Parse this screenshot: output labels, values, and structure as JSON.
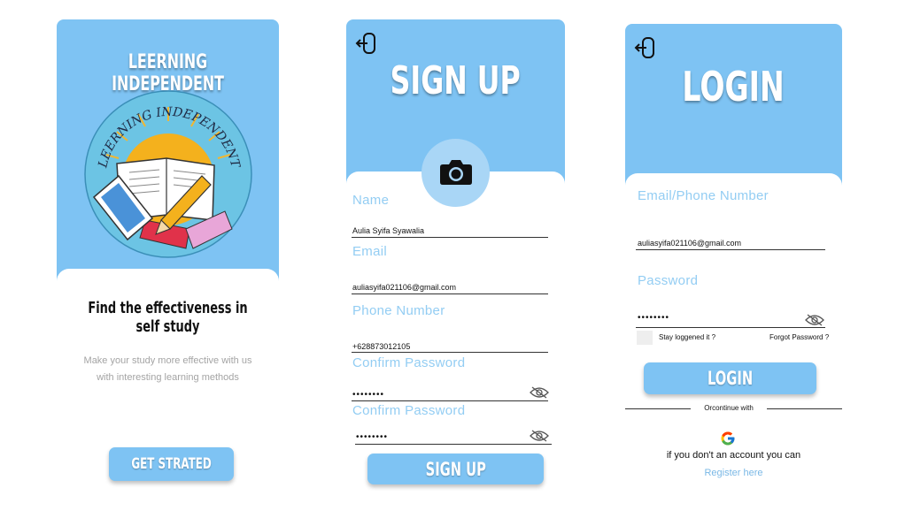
{
  "screen1": {
    "title": "LEERNING INDEPENDENT",
    "logo_text": "LEERNING INDEPENDENT",
    "headline": "Find the effectiveness in self study",
    "desc_line1": "Make your study more effective with us",
    "desc_line2": "with interesting learning methods",
    "button": "GET STRATED"
  },
  "screen2": {
    "title": "SIGN UP",
    "fields": [
      {
        "label": "Name",
        "value": "Aulia Syifa Syawalia"
      },
      {
        "label": "Email",
        "value": "auliasyifa021106@gmail.com"
      },
      {
        "label": "Phone Number",
        "value": "+628873012105"
      },
      {
        "label": "Confirm Password",
        "value": "••••••••"
      },
      {
        "label": "Confirm Password",
        "value": "••••••••"
      }
    ],
    "button": "SIGN UP"
  },
  "screen3": {
    "title": "LOGIN",
    "email_label": "Email/Phone Number",
    "email_value": "auliasyifa021106@gmail.com",
    "password_label": "Password",
    "password_value": "••••••••",
    "stay_logged": "Stay loggened it ?",
    "forgot": "Forgot Password ?",
    "button": "LOGIN",
    "divider": "Orcontinue with",
    "no_account": "if you don't an account you can",
    "register": "Register here"
  },
  "colors": {
    "primary": "#7ec3f3",
    "label": "#93cdf3",
    "link": "#7ab8e6"
  },
  "icons": [
    "back-door-icon",
    "camera-icon",
    "eye-off-icon",
    "google-icon"
  ]
}
